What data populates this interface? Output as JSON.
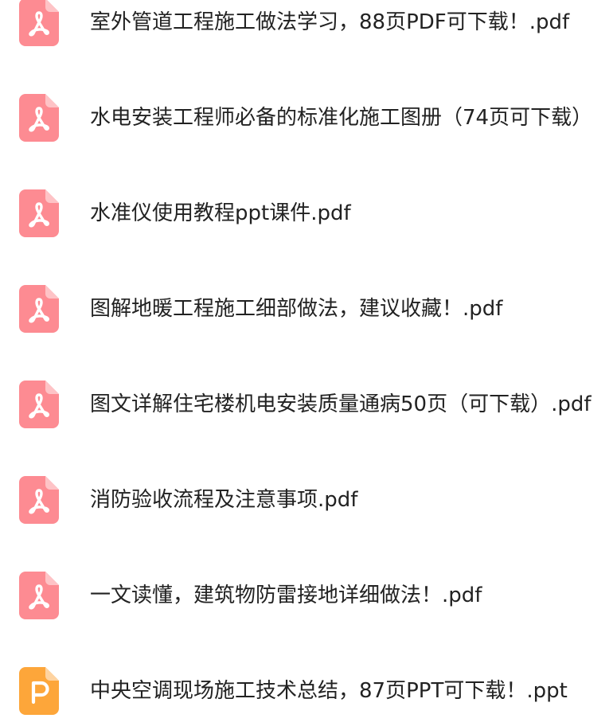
{
  "colors": {
    "pdf_icon": "#fd8b92",
    "ppt_icon": "#fda63a",
    "text": "#222222",
    "background": "#ffffff"
  },
  "files": [
    {
      "name": "室外管道工程施工做法学习，88页PDF可下载！.pdf",
      "type": "pdf",
      "icon": "pdf-icon"
    },
    {
      "name": "水电安装工程师必备的标准化施工图册（74页可下载）",
      "type": "pdf",
      "icon": "pdf-icon"
    },
    {
      "name": "水准仪使用教程ppt课件.pdf",
      "type": "pdf",
      "icon": "pdf-icon"
    },
    {
      "name": "图解地暖工程施工细部做法，建议收藏！.pdf",
      "type": "pdf",
      "icon": "pdf-icon"
    },
    {
      "name": "图文详解住宅楼机电安装质量通病50页（可下载）.pdf",
      "type": "pdf",
      "icon": "pdf-icon"
    },
    {
      "name": "消防验收流程及注意事项.pdf",
      "type": "pdf",
      "icon": "pdf-icon"
    },
    {
      "name": "一文读懂，建筑物防雷接地详细做法！.pdf",
      "type": "pdf",
      "icon": "pdf-icon"
    },
    {
      "name": "中央空调现场施工技术总结，87页PPT可下载！.ppt",
      "type": "ppt",
      "icon": "ppt-icon"
    }
  ]
}
